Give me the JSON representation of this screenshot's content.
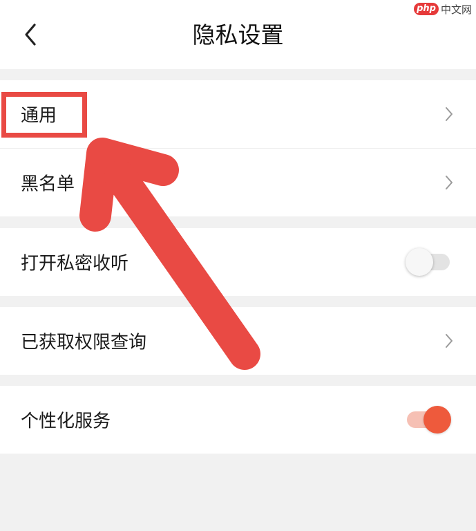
{
  "header": {
    "title": "隐私设置",
    "back_icon": "chevron-left-icon"
  },
  "watermark": {
    "logo": "php",
    "text": "中文网"
  },
  "rows": [
    {
      "label": "通用",
      "control": "chevron"
    },
    {
      "label": "黑名单",
      "control": "chevron"
    },
    {
      "label": "打开私密收听",
      "control": "toggle",
      "toggle_on": false
    },
    {
      "label": "已获取权限查询",
      "control": "chevron"
    },
    {
      "label": "个性化服务",
      "control": "toggle",
      "toggle_on": true
    }
  ],
  "colors": {
    "accent": "#ee5a3c",
    "annotation": "#e94a44",
    "background": "#f1f1f1"
  }
}
